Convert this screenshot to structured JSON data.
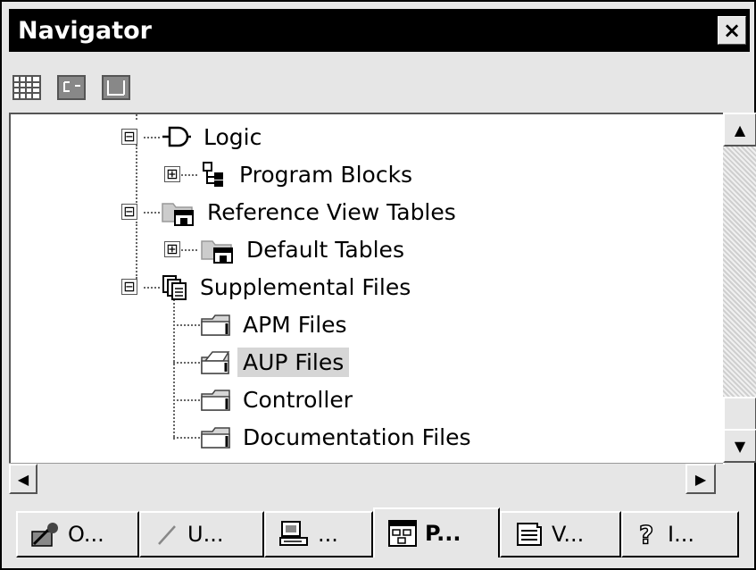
{
  "window": {
    "title": "Navigator",
    "close_label": "×"
  },
  "toolbar": {
    "buttons": [
      "grid-view-icon",
      "list-view-icon",
      "detail-view-icon"
    ]
  },
  "tree": {
    "items": [
      {
        "label": "Logic",
        "icon": "logic-gate-icon",
        "expander": "⊟"
      },
      {
        "label": "Program Blocks",
        "icon": "program-blocks-icon",
        "expander": "⊞"
      },
      {
        "label": "Reference View Tables",
        "icon": "table-folder-icon",
        "expander": "⊟"
      },
      {
        "label": "Default Tables",
        "icon": "table-folder-icon",
        "expander": "⊞"
      },
      {
        "label": "Supplemental Files",
        "icon": "supplemental-files-icon",
        "expander": "⊟"
      },
      {
        "label": "APM Files",
        "icon": "folder-icon"
      },
      {
        "label": "AUP Files",
        "icon": "open-folder-icon",
        "selected": true
      },
      {
        "label": "Controller",
        "icon": "folder-icon"
      },
      {
        "label": "Documentation Files",
        "icon": "folder-icon"
      }
    ]
  },
  "scroll": {
    "up": "▲",
    "down": "▼",
    "left": "◀",
    "right": "▶"
  },
  "tabs": [
    {
      "label": "O...",
      "icon": "tools-icon"
    },
    {
      "label": "U...",
      "icon": "pencil-icon"
    },
    {
      "label": "...",
      "icon": "computer-icon"
    },
    {
      "label": "P...",
      "icon": "project-icon",
      "active": true
    },
    {
      "label": "V...",
      "icon": "view-icon"
    },
    {
      "label": "I...",
      "icon": "help-icon"
    }
  ]
}
